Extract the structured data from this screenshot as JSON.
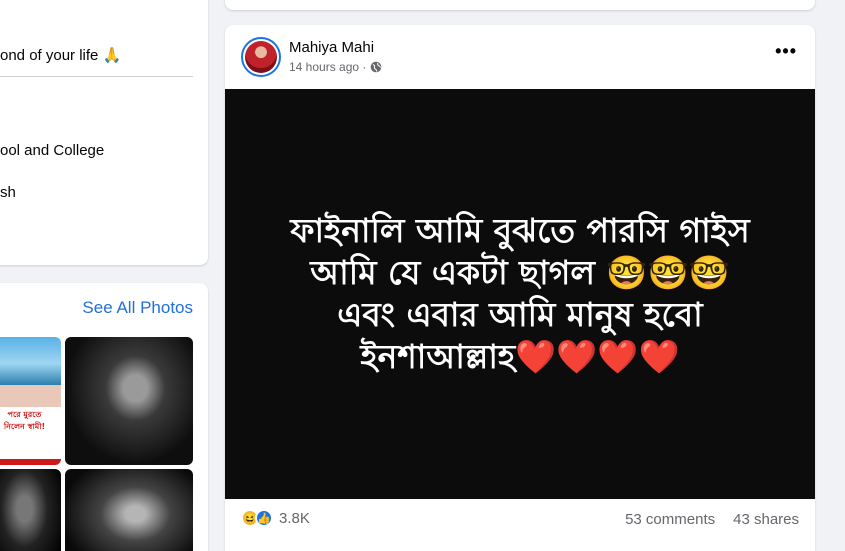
{
  "intro": {
    "line1": "ond of your life 🙏",
    "line2": "ool and College",
    "line3": "sh"
  },
  "photos": {
    "see_all_label": "See All Photos",
    "thumb1_text_a": "পরে মুরতে",
    "thumb1_text_b": "নিলেন স্বামী!"
  },
  "post": {
    "author": "Mahiya Mahi",
    "timestamp": "14 hours ago ·",
    "more_label": "•••",
    "text_lines": [
      "ফাইনালি আমি বুঝতে পারসি গাইস",
      "আমি যে একটা ছাগল 🤓🤓🤓",
      "এবং এবার আমি মানুষ হবো",
      "ইনশাআল্লাহ❤️❤️❤️❤️"
    ],
    "reaction_count": "3.8K",
    "comments": "53 comments",
    "shares": "43 shares"
  }
}
